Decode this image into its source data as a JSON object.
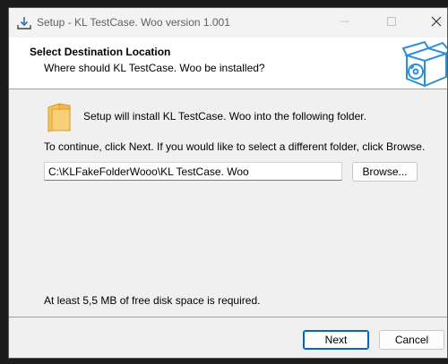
{
  "window": {
    "title": "Setup - KL TestCase. Woo version 1.001"
  },
  "header": {
    "title": "Select Destination Location",
    "subtitle": "Where should KL TestCase. Woo be installed?"
  },
  "body": {
    "intro": "Setup will install KL TestCase. Woo into the following folder.",
    "instruction": "To continue, click Next. If you would like to select a different folder, click Browse.",
    "path_value": "C:\\KLFakeFolderWooo\\KL TestCase. Woo",
    "browse_label": "Browse...",
    "disk_space": "At least 5,5 MB of free disk space is required."
  },
  "footer": {
    "next_label": "Next",
    "cancel_label": "Cancel"
  },
  "icons": {
    "title": "installer-download-icon",
    "header": "software-box-disc-icon",
    "folder": "folder-icon"
  },
  "colors": {
    "accent": "#0067c0",
    "box_icon": "#2b8fd6",
    "folder": "#f2b84b"
  }
}
